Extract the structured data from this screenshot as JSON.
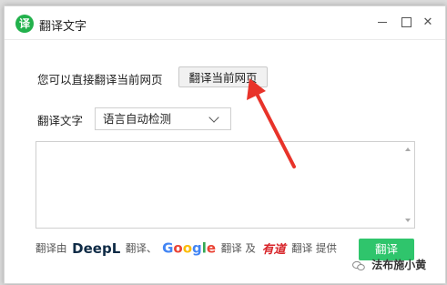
{
  "window": {
    "icon_glyph": "译",
    "title": "翻译文字"
  },
  "page_translate": {
    "label": "您可以直接翻译当前网页",
    "button_label": "翻译当前网页"
  },
  "text_translate": {
    "label": "翻译文字",
    "language_selected": "语言自动检测",
    "input_value": ""
  },
  "footer": {
    "prefix": "翻译由",
    "deepl_logo": "DeepL",
    "deepl_suffix": "翻译、",
    "google_letters": [
      "G",
      "o",
      "o",
      "g",
      "l",
      "e"
    ],
    "google_suffix": "翻译",
    "and": "及",
    "youdao_logo": "有道",
    "youdao_suffix": "翻译",
    "suffix": "提供"
  },
  "submit_button_label": "翻译",
  "watermark": "法布施小黄",
  "colors": {
    "accent_green": "#2fc56c",
    "app_icon_green": "#22b14c",
    "annotation_arrow": "#e8332a"
  },
  "icons": {
    "minimize": "minimize-icon",
    "maximize": "maximize-icon",
    "close": "close-icon",
    "dropdown": "chevron-down-icon"
  }
}
